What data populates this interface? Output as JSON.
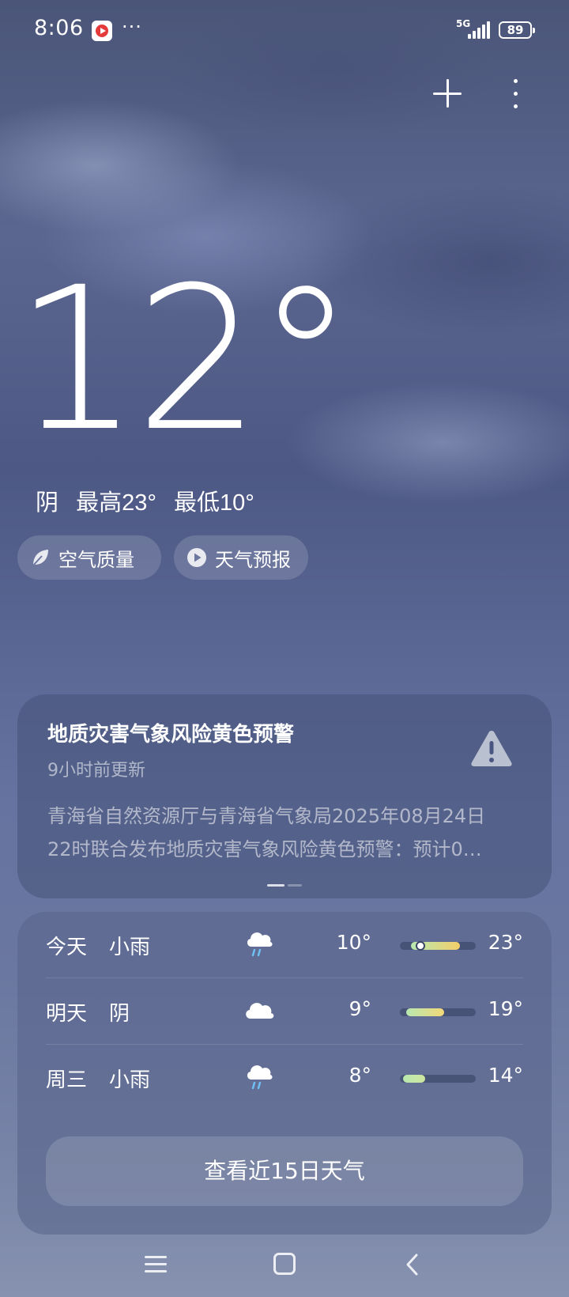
{
  "status_bar": {
    "time": "8:06",
    "more": "···",
    "network": "5G",
    "battery": "89"
  },
  "current": {
    "temperature": "12°",
    "condition": "阴",
    "high": "最高23°",
    "low": "最低10°"
  },
  "chips": {
    "air_quality": "空气质量",
    "forecast_video": "天气预报"
  },
  "warning": {
    "title": "地质灾害气象风险黄色预警",
    "updated": "9小时前更新",
    "line1": "青海省自然资源厅与青海省气象局2025年08月24日",
    "line2": "22时联合发布地质灾害气象风险黄色预警：预计0…",
    "accent": "#b9c0d0"
  },
  "forecast": {
    "rows": [
      {
        "day": "今天",
        "condition": "小雨",
        "icon": "light-rain-icon",
        "low": "10°",
        "high": "23°"
      },
      {
        "day": "明天",
        "condition": "阴",
        "icon": "overcast-cloud-icon",
        "low": "9°",
        "high": "19°"
      },
      {
        "day": "周三",
        "condition": "小雨",
        "icon": "light-rain-icon",
        "low": "8°",
        "high": "14°"
      }
    ],
    "button_label": "查看近15日天气",
    "colors": {
      "cool": "#b8e8b0",
      "warm": "#f2cf6a",
      "rain": "#6fc1f5"
    }
  }
}
